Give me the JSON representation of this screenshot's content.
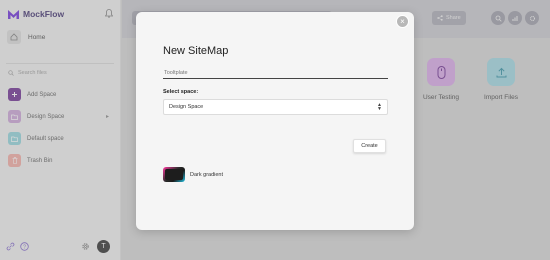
{
  "app": {
    "brand": "MockFlow",
    "sidebar": {
      "home": "Home",
      "search_placeholder": "Search files",
      "items": [
        {
          "label": "Add Space",
          "icon": "plus-icon",
          "color": "#6b2a8f"
        },
        {
          "label": "Design Space",
          "icon": "folder-icon",
          "color": "#c9a1d6"
        },
        {
          "label": "Default space",
          "icon": "folder-icon",
          "color": "#8fd3da"
        },
        {
          "label": "Trash Bin",
          "icon": "trash-icon",
          "color": "#f2a9a2"
        }
      ]
    },
    "avatar_initial": "T",
    "topbar": {
      "share_label": "Share"
    },
    "features": [
      {
        "label": "User Testing",
        "icon": "user-testing-icon",
        "color": "#d8a6e6"
      },
      {
        "label": "Import Files",
        "icon": "import-icon",
        "color": "#9fd6e0"
      }
    ]
  },
  "modal": {
    "title": "New SiteMap",
    "name_input": {
      "value": "",
      "placeholder": "Tooltplate"
    },
    "space_label": "Select space:",
    "space_selected": "Design Space",
    "create_label": "Create",
    "close_label": "×",
    "theme_label": "Dark gradient"
  }
}
